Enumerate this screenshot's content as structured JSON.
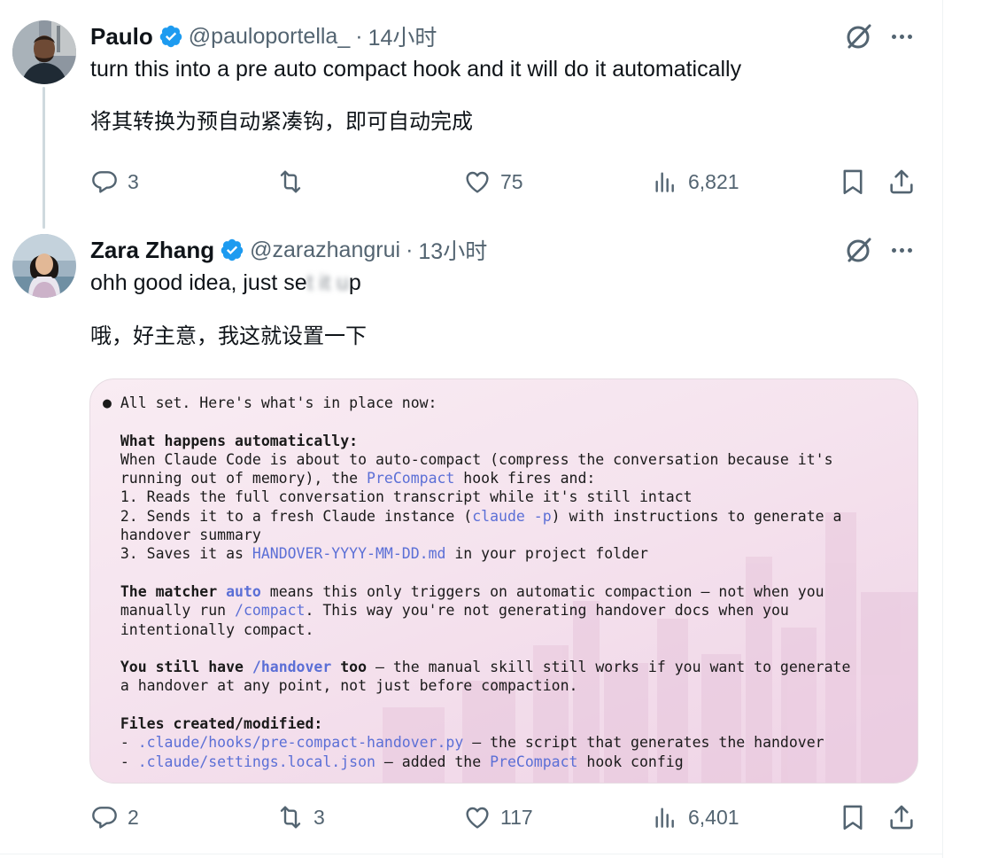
{
  "tweets": [
    {
      "name": "Paulo",
      "handle": "@pauloportella_",
      "separator": "·",
      "time": "14小时",
      "text": "turn this into a pre auto compact hook and it will do it automatically",
      "translation": "将其转换为预自动紧凑钩，即可自动完成",
      "replies": "3",
      "reposts": "",
      "likes": "75",
      "views": "6,821"
    },
    {
      "name": "Zara Zhang",
      "handle": "@zarazhangrui",
      "separator": "·",
      "time": "13小时",
      "text": "ohh good idea, just se",
      "text_obscured": "t it u",
      "text_end": "p",
      "translation": "哦，好主意，我这就设置一下",
      "replies": "2",
      "reposts": "3",
      "likes": "117",
      "views": "6,401"
    }
  ],
  "code_block": {
    "intro": "All set. Here's what's in place now:",
    "h1": "What happens automatically:",
    "p1_a": "When Claude Code is about to auto-compact (compress the conversation because it's",
    "p1_b": "running out of memory), the ",
    "p1_link": "PreCompact",
    "p1_c": " hook fires and:",
    "step1": "1. Reads the full conversation transcript while it's still intact",
    "step2_a": "2. Sends it to a fresh Claude instance (",
    "step2_link": "claude -p",
    "step2_b": ") with instructions to generate a",
    "step2_c": "handover summary",
    "step3_a": "3. Saves it as ",
    "step3_link": "HANDOVER-YYYY-MM-DD.md",
    "step3_b": " in your project folder",
    "h2_a": "The matcher ",
    "h2_link": "auto",
    "p2_a": " means this only triggers on automatic compaction — not when you",
    "p2_b": "manually run ",
    "p2_link": "/compact",
    "p2_c": ". This way you're not generating handover docs when you",
    "p2_d": "intentionally compact.",
    "h3_a": "You still have ",
    "h3_link": "/handover",
    "h3_b": " too",
    "p3_a": " — the manual skill still works if you want to generate",
    "p3_b": "a handover at any point, not just before compaction.",
    "h4": "Files created/modified:",
    "f1_dash": "- ",
    "f1_link": ".claude/hooks/pre-compact-handover.py",
    "f1_text": " — the script that generates the handover",
    "f2_dash": "- ",
    "f2_link": ".claude/settings.local.json",
    "f2_text": " — added the ",
    "f2_link2": "PreCompact",
    "f2_end": " hook config"
  },
  "colors": {
    "verified": "#1d9bf0",
    "muted": "#536471",
    "link": "#5b6fd6"
  }
}
